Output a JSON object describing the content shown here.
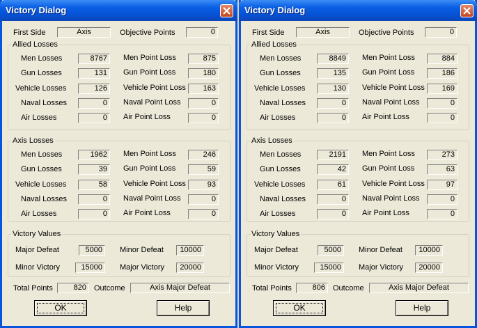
{
  "dialogs": [
    {
      "title": "Victory Dialog",
      "first_side_label": "First Side",
      "first_side": "Axis",
      "objective_points_label": "Objective Points",
      "objective_points": "0",
      "allied": {
        "legend": "Allied Losses",
        "rows": [
          {
            "loss_label": "Men Losses",
            "loss": "8767",
            "point_label": "Men Point Loss",
            "point": "875"
          },
          {
            "loss_label": "Gun Losses",
            "loss": "131",
            "point_label": "Gun Point Loss",
            "point": "180"
          },
          {
            "loss_label": "Vehicle Losses",
            "loss": "126",
            "point_label": "Vehicle Point Loss",
            "point": "163"
          },
          {
            "loss_label": "Naval Losses",
            "loss": "0",
            "point_label": "Naval Point Loss",
            "point": "0"
          },
          {
            "loss_label": "Air Losses",
            "loss": "0",
            "point_label": "Air Point Loss",
            "point": "0"
          }
        ]
      },
      "axis": {
        "legend": "Axis Losses",
        "rows": [
          {
            "loss_label": "Men Losses",
            "loss": "1962",
            "point_label": "Men Point Loss",
            "point": "246"
          },
          {
            "loss_label": "Gun Losses",
            "loss": "39",
            "point_label": "Gun Point Loss",
            "point": "59"
          },
          {
            "loss_label": "Vehicle Losses",
            "loss": "58",
            "point_label": "Vehicle Point Loss",
            "point": "93"
          },
          {
            "loss_label": "Naval Losses",
            "loss": "0",
            "point_label": "Naval Point Loss",
            "point": "0"
          },
          {
            "loss_label": "Air Losses",
            "loss": "0",
            "point_label": "Air Point Loss",
            "point": "0"
          }
        ]
      },
      "victory": {
        "legend": "Victory Values",
        "major_defeat_label": "Major Defeat",
        "major_defeat": "5000",
        "minor_defeat_label": "Minor Defeat",
        "minor_defeat": "10000",
        "minor_victory_label": "Minor Victory",
        "minor_victory": "15000",
        "major_victory_label": "Major Victory",
        "major_victory": "20000"
      },
      "total_points_label": "Total Points",
      "total_points": "820",
      "outcome_label": "Outcome",
      "outcome": "Axis Major Defeat",
      "ok_label": "OK",
      "help_label": "Help"
    },
    {
      "title": "Victory Dialog",
      "first_side_label": "First Side",
      "first_side": "Axis",
      "objective_points_label": "Objective Points",
      "objective_points": "0",
      "allied": {
        "legend": "Allied Losses",
        "rows": [
          {
            "loss_label": "Men Losses",
            "loss": "8849",
            "point_label": "Men Point Loss",
            "point": "884"
          },
          {
            "loss_label": "Gun Losses",
            "loss": "135",
            "point_label": "Gun Point Loss",
            "point": "186"
          },
          {
            "loss_label": "Vehicle Losses",
            "loss": "130",
            "point_label": "Vehicle Point Loss",
            "point": "169"
          },
          {
            "loss_label": "Naval Losses",
            "loss": "0",
            "point_label": "Naval Point Loss",
            "point": "0"
          },
          {
            "loss_label": "Air Losses",
            "loss": "0",
            "point_label": "Air Point Loss",
            "point": "0"
          }
        ]
      },
      "axis": {
        "legend": "Axis Losses",
        "rows": [
          {
            "loss_label": "Men Losses",
            "loss": "2191",
            "point_label": "Men Point Loss",
            "point": "273"
          },
          {
            "loss_label": "Gun Losses",
            "loss": "42",
            "point_label": "Gun Point Loss",
            "point": "63"
          },
          {
            "loss_label": "Vehicle Losses",
            "loss": "61",
            "point_label": "Vehicle Point Loss",
            "point": "97"
          },
          {
            "loss_label": "Naval Losses",
            "loss": "0",
            "point_label": "Naval Point Loss",
            "point": "0"
          },
          {
            "loss_label": "Air Losses",
            "loss": "0",
            "point_label": "Air Point Loss",
            "point": "0"
          }
        ]
      },
      "victory": {
        "legend": "Victory Values",
        "major_defeat_label": "Major Defeat",
        "major_defeat": "5000",
        "minor_defeat_label": "Minor Defeat",
        "minor_defeat": "10000",
        "minor_victory_label": "Minor Victory",
        "minor_victory": "15000",
        "major_victory_label": "Major Victory",
        "major_victory": "20000"
      },
      "total_points_label": "Total Points",
      "total_points": "806",
      "outcome_label": "Outcome",
      "outcome": "Axis Major Defeat",
      "ok_label": "OK",
      "help_label": "Help"
    }
  ],
  "icons": {
    "close": "close-x-icon"
  },
  "colors": {
    "titlebar": "#0a5fe3",
    "close_button": "#c4451e",
    "dialog_bg": "#ece9d8"
  }
}
